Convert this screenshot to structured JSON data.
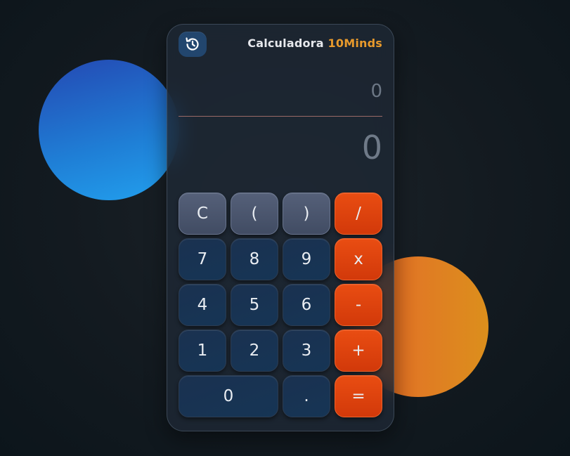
{
  "theme": {
    "accent": "#e89a2c",
    "operator_color": "#e94d12",
    "number_key_color": "#163555",
    "function_key_color": "#4c5770"
  },
  "header": {
    "history_icon": "history-icon",
    "title": "Calculadora",
    "title_accent": "10Minds"
  },
  "display": {
    "expression": "0",
    "result": "0"
  },
  "keys": {
    "clear": "C",
    "paren_open": "(",
    "paren_close": ")",
    "divide": "/",
    "seven": "7",
    "eight": "8",
    "nine": "9",
    "multiply": "x",
    "four": "4",
    "five": "5",
    "six": "6",
    "subtract": "-",
    "one": "1",
    "two": "2",
    "three": "3",
    "add": "+",
    "zero": "0",
    "decimal": ".",
    "equals": "="
  }
}
